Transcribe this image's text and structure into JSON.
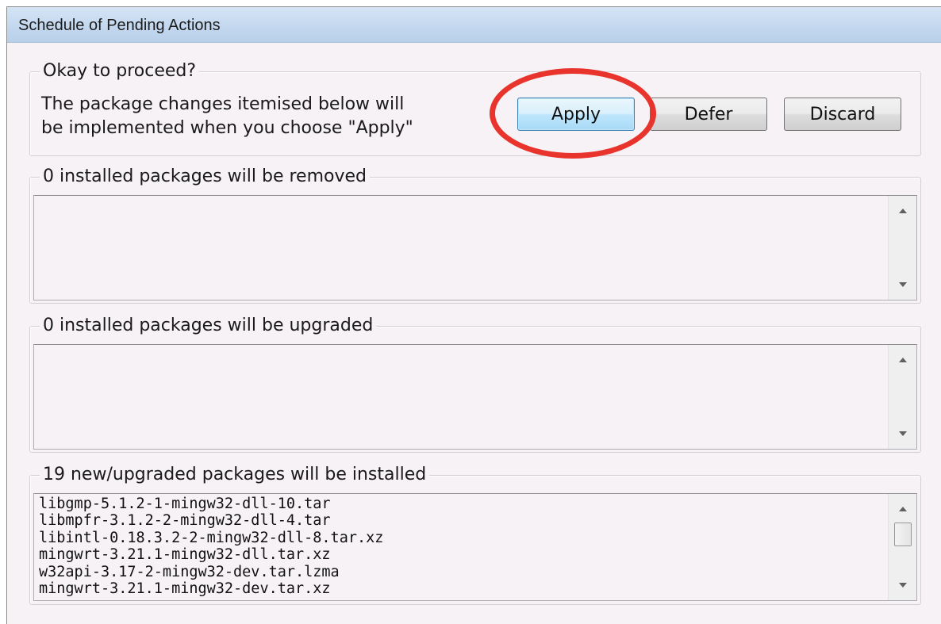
{
  "window": {
    "title": "Schedule of Pending Actions"
  },
  "proceed": {
    "group_title": "Okay to proceed?",
    "message_lines": [
      "The package changes itemised below will",
      "be implemented when you choose \"Apply\""
    ],
    "buttons": {
      "apply": "Apply",
      "defer": "Defer",
      "discard": "Discard"
    }
  },
  "removed": {
    "group_title": "0 installed packages will be removed",
    "items": []
  },
  "upgraded": {
    "group_title": "0 installed packages will be upgraded",
    "items": []
  },
  "installed": {
    "group_title": "19 new/upgraded packages will be installed",
    "items": [
      "libgmp-5.1.2-1-mingw32-dll-10.tar",
      "libmpfr-3.1.2-2-mingw32-dll-4.tar",
      "libintl-0.18.3.2-2-mingw32-dll-8.tar.xz",
      "mingwrt-3.21.1-mingw32-dll.tar.xz",
      "w32api-3.17-2-mingw32-dev.tar.lzma",
      "mingwrt-3.21.1-mingw32-dev.tar.xz"
    ]
  },
  "annotation": {
    "ring_color": "#e8342c"
  }
}
